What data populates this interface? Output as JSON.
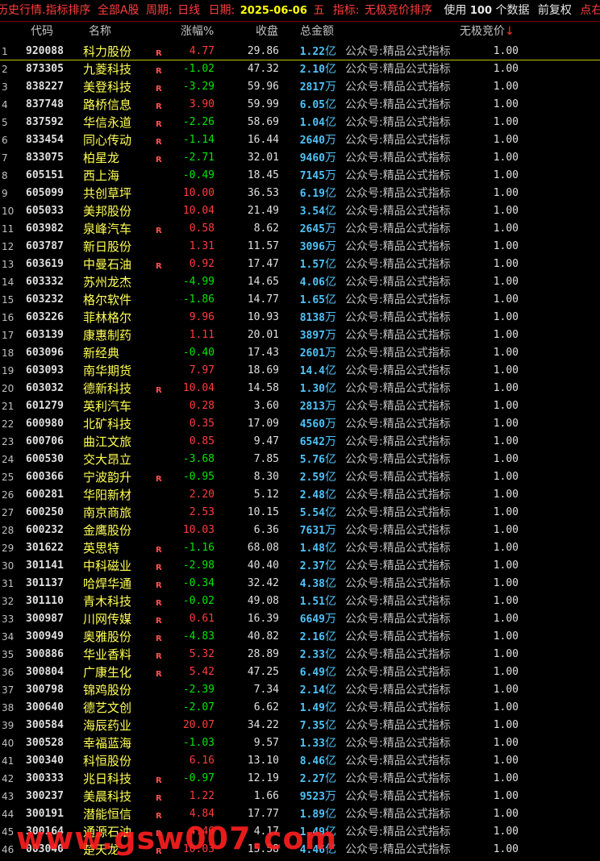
{
  "titlebar": {
    "part1": "历史行情.指标排序",
    "part2": "全部A股",
    "period_label": "周期:",
    "period_value": "日线",
    "date_label": "日期:",
    "date_value": "2025-06-06",
    "weekday": "五",
    "indicator_label": "指标:",
    "indicator_value": "无极竞价排序",
    "use_label": "使用",
    "use_count": "100",
    "use_suffix": "个数据",
    "adjust": "前复权",
    "tail": "点右"
  },
  "columns": {
    "code": "代码",
    "name": "名称",
    "change": "涨幅%",
    "close": "收盘",
    "amount": "总金额",
    "indicator": "无极竞价",
    "sort_arrow": "↓"
  },
  "colors": {
    "up": "#ff3c3c",
    "down": "#00e600",
    "name": "#ffff54",
    "amount": "#4fc3f7"
  },
  "rows": [
    {
      "idx": "1",
      "code": "920088",
      "name": "科力股份",
      "r": "R",
      "chg": "4.77",
      "close": "29.86",
      "amt": "1.22",
      "unit": "亿",
      "note": "公众号:精品公式指标",
      "val": "1.00"
    },
    {
      "idx": "2",
      "code": "873305",
      "name": "九菱科技",
      "r": "R",
      "chg": "-1.02",
      "close": "47.32",
      "amt": "2.10",
      "unit": "亿",
      "note": "公众号:精品公式指标",
      "val": "1.00"
    },
    {
      "idx": "3",
      "code": "838227",
      "name": "美登科技",
      "r": "R",
      "chg": "-3.29",
      "close": "59.96",
      "amt": "2817",
      "unit": "万",
      "note": "公众号:精品公式指标",
      "val": "1.00"
    },
    {
      "idx": "4",
      "code": "837748",
      "name": "路桥信息",
      "r": "R",
      "chg": "3.90",
      "close": "59.99",
      "amt": "6.05",
      "unit": "亿",
      "note": "公众号:精品公式指标",
      "val": "1.00"
    },
    {
      "idx": "5",
      "code": "837592",
      "name": "华信永道",
      "r": "R",
      "chg": "-2.26",
      "close": "58.69",
      "amt": "1.04",
      "unit": "亿",
      "note": "公众号:精品公式指标",
      "val": "1.00"
    },
    {
      "idx": "6",
      "code": "833454",
      "name": "同心传动",
      "r": "R",
      "chg": "-1.14",
      "close": "16.44",
      "amt": "2640",
      "unit": "万",
      "note": "公众号:精品公式指标",
      "val": "1.00"
    },
    {
      "idx": "7",
      "code": "833075",
      "name": "柏星龙",
      "r": "R",
      "chg": "-2.71",
      "close": "32.01",
      "amt": "9460",
      "unit": "万",
      "note": "公众号:精品公式指标",
      "val": "1.00"
    },
    {
      "idx": "8",
      "code": "605151",
      "name": "西上海",
      "r": "",
      "chg": "-0.49",
      "close": "18.45",
      "amt": "7145",
      "unit": "万",
      "note": "公众号:精品公式指标",
      "val": "1.00"
    },
    {
      "idx": "9",
      "code": "605099",
      "name": "共创草坪",
      "r": "",
      "chg": "10.00",
      "close": "36.53",
      "amt": "6.19",
      "unit": "亿",
      "note": "公众号:精品公式指标",
      "val": "1.00"
    },
    {
      "idx": "10",
      "code": "605033",
      "name": "美邦股份",
      "r": "",
      "chg": "10.04",
      "close": "21.49",
      "amt": "3.54",
      "unit": "亿",
      "note": "公众号:精品公式指标",
      "val": "1.00"
    },
    {
      "idx": "11",
      "code": "603982",
      "name": "泉峰汽车",
      "r": "R",
      "chg": "0.58",
      "close": "8.62",
      "amt": "2645",
      "unit": "万",
      "note": "公众号:精品公式指标",
      "val": "1.00"
    },
    {
      "idx": "12",
      "code": "603787",
      "name": "新日股份",
      "r": "",
      "chg": "1.31",
      "close": "11.57",
      "amt": "3096",
      "unit": "万",
      "note": "公众号:精品公式指标",
      "val": "1.00"
    },
    {
      "idx": "13",
      "code": "603619",
      "name": "中曼石油",
      "r": "R",
      "chg": "0.92",
      "close": "17.47",
      "amt": "1.57",
      "unit": "亿",
      "note": "公众号:精品公式指标",
      "val": "1.00"
    },
    {
      "idx": "14",
      "code": "603332",
      "name": "苏州龙杰",
      "r": "",
      "chg": "-4.99",
      "close": "14.65",
      "amt": "4.06",
      "unit": "亿",
      "note": "公众号:精品公式指标",
      "val": "1.00"
    },
    {
      "idx": "15",
      "code": "603232",
      "name": "格尔软件",
      "r": "",
      "chg": "-1.86",
      "close": "14.77",
      "amt": "1.65",
      "unit": "亿",
      "note": "公众号:精品公式指标",
      "val": "1.00"
    },
    {
      "idx": "16",
      "code": "603226",
      "name": "菲林格尔",
      "r": "",
      "chg": "9.96",
      "close": "10.93",
      "amt": "8138",
      "unit": "万",
      "note": "公众号:精品公式指标",
      "val": "1.00"
    },
    {
      "idx": "17",
      "code": "603139",
      "name": "康惠制药",
      "r": "",
      "chg": "1.11",
      "close": "20.01",
      "amt": "3897",
      "unit": "万",
      "note": "公众号:精品公式指标",
      "val": "1.00"
    },
    {
      "idx": "18",
      "code": "603096",
      "name": "新经典",
      "r": "",
      "chg": "-0.40",
      "close": "17.43",
      "amt": "2601",
      "unit": "万",
      "note": "公众号:精品公式指标",
      "val": "1.00"
    },
    {
      "idx": "19",
      "code": "603093",
      "name": "南华期货",
      "r": "",
      "chg": "7.97",
      "close": "18.69",
      "amt": "14.4",
      "unit": "亿",
      "note": "公众号:精品公式指标",
      "val": "1.00"
    },
    {
      "idx": "20",
      "code": "603032",
      "name": "德新科技",
      "r": "R",
      "chg": "10.04",
      "close": "14.58",
      "amt": "1.30",
      "unit": "亿",
      "note": "公众号:精品公式指标",
      "val": "1.00"
    },
    {
      "idx": "21",
      "code": "601279",
      "name": "英利汽车",
      "r": "",
      "chg": "0.28",
      "close": "3.60",
      "amt": "2813",
      "unit": "万",
      "note": "公众号:精品公式指标",
      "val": "1.00"
    },
    {
      "idx": "22",
      "code": "600980",
      "name": "北矿科技",
      "r": "",
      "chg": "0.35",
      "close": "17.09",
      "amt": "4560",
      "unit": "万",
      "note": "公众号:精品公式指标",
      "val": "1.00"
    },
    {
      "idx": "23",
      "code": "600706",
      "name": "曲江文旅",
      "r": "",
      "chg": "0.85",
      "close": "9.47",
      "amt": "6542",
      "unit": "万",
      "note": "公众号:精品公式指标",
      "val": "1.00"
    },
    {
      "idx": "24",
      "code": "600530",
      "name": "交大昂立",
      "r": "",
      "chg": "-3.68",
      "close": "7.85",
      "amt": "5.76",
      "unit": "亿",
      "note": "公众号:精品公式指标",
      "val": "1.00"
    },
    {
      "idx": "25",
      "code": "600366",
      "name": "宁波韵升",
      "r": "R",
      "chg": "-0.95",
      "close": "8.30",
      "amt": "2.59",
      "unit": "亿",
      "note": "公众号:精品公式指标",
      "val": "1.00"
    },
    {
      "idx": "26",
      "code": "600281",
      "name": "华阳新材",
      "r": "",
      "chg": "2.20",
      "close": "5.12",
      "amt": "2.48",
      "unit": "亿",
      "note": "公众号:精品公式指标",
      "val": "1.00"
    },
    {
      "idx": "27",
      "code": "600250",
      "name": "南京商旅",
      "r": "",
      "chg": "2.53",
      "close": "10.15",
      "amt": "5.54",
      "unit": "亿",
      "note": "公众号:精品公式指标",
      "val": "1.00"
    },
    {
      "idx": "28",
      "code": "600232",
      "name": "金鹰股份",
      "r": "",
      "chg": "10.03",
      "close": "6.36",
      "amt": "7631",
      "unit": "万",
      "note": "公众号:精品公式指标",
      "val": "1.00"
    },
    {
      "idx": "29",
      "code": "301622",
      "name": "英思特",
      "r": "R",
      "chg": "-1.16",
      "close": "68.08",
      "amt": "1.48",
      "unit": "亿",
      "note": "公众号:精品公式指标",
      "val": "1.00"
    },
    {
      "idx": "30",
      "code": "301141",
      "name": "中科磁业",
      "r": "R",
      "chg": "-2.98",
      "close": "40.40",
      "amt": "2.37",
      "unit": "亿",
      "note": "公众号:精品公式指标",
      "val": "1.00"
    },
    {
      "idx": "31",
      "code": "301137",
      "name": "哈焊华通",
      "r": "R",
      "chg": "-0.34",
      "close": "32.42",
      "amt": "4.38",
      "unit": "亿",
      "note": "公众号:精品公式指标",
      "val": "1.00"
    },
    {
      "idx": "32",
      "code": "301110",
      "name": "青木科技",
      "r": "R",
      "chg": "-0.02",
      "close": "49.08",
      "amt": "1.51",
      "unit": "亿",
      "note": "公众号:精品公式指标",
      "val": "1.00"
    },
    {
      "idx": "33",
      "code": "300987",
      "name": "川网传媒",
      "r": "R",
      "chg": "0.61",
      "close": "16.39",
      "amt": "6649",
      "unit": "万",
      "note": "公众号:精品公式指标",
      "val": "1.00"
    },
    {
      "idx": "34",
      "code": "300949",
      "name": "奥雅股份",
      "r": "R",
      "chg": "-4.83",
      "close": "40.82",
      "amt": "2.16",
      "unit": "亿",
      "note": "公众号:精品公式指标",
      "val": "1.00"
    },
    {
      "idx": "35",
      "code": "300886",
      "name": "华业香料",
      "r": "R",
      "chg": "5.32",
      "close": "28.89",
      "amt": "2.33",
      "unit": "亿",
      "note": "公众号:精品公式指标",
      "val": "1.00"
    },
    {
      "idx": "36",
      "code": "300804",
      "name": "广康生化",
      "r": "R",
      "chg": "5.42",
      "close": "47.25",
      "amt": "6.49",
      "unit": "亿",
      "note": "公众号:精品公式指标",
      "val": "1.00"
    },
    {
      "idx": "37",
      "code": "300798",
      "name": "锦鸡股份",
      "r": "",
      "chg": "-2.39",
      "close": "7.34",
      "amt": "2.14",
      "unit": "亿",
      "note": "公众号:精品公式指标",
      "val": "1.00"
    },
    {
      "idx": "38",
      "code": "300640",
      "name": "德艺文创",
      "r": "",
      "chg": "-2.07",
      "close": "6.62",
      "amt": "1.49",
      "unit": "亿",
      "note": "公众号:精品公式指标",
      "val": "1.00"
    },
    {
      "idx": "39",
      "code": "300584",
      "name": "海辰药业",
      "r": "",
      "chg": "20.07",
      "close": "34.22",
      "amt": "7.35",
      "unit": "亿",
      "note": "公众号:精品公式指标",
      "val": "1.00"
    },
    {
      "idx": "40",
      "code": "300528",
      "name": "幸福蓝海",
      "r": "",
      "chg": "-1.03",
      "close": "9.57",
      "amt": "1.33",
      "unit": "亿",
      "note": "公众号:精品公式指标",
      "val": "1.00"
    },
    {
      "idx": "41",
      "code": "300340",
      "name": "科恒股份",
      "r": "",
      "chg": "6.16",
      "close": "13.10",
      "amt": "8.46",
      "unit": "亿",
      "note": "公众号:精品公式指标",
      "val": "1.00"
    },
    {
      "idx": "42",
      "code": "300333",
      "name": "兆日科技",
      "r": "R",
      "chg": "-0.97",
      "close": "12.19",
      "amt": "2.27",
      "unit": "亿",
      "note": "公众号:精品公式指标",
      "val": "1.00"
    },
    {
      "idx": "43",
      "code": "300237",
      "name": "美晨科技",
      "r": "R",
      "chg": "1.22",
      "close": "1.66",
      "amt": "9523",
      "unit": "万",
      "note": "公众号:精品公式指标",
      "val": "1.00"
    },
    {
      "idx": "44",
      "code": "300191",
      "name": "潜能恒信",
      "r": "R",
      "chg": "4.84",
      "close": "17.77",
      "amt": "1.89",
      "unit": "亿",
      "note": "公众号:精品公式指标",
      "val": "1.00"
    },
    {
      "idx": "45",
      "code": "300164",
      "name": "通源石油",
      "r": "R",
      "chg": "4.46",
      "close": "4.17",
      "amt": "1.49",
      "unit": "亿",
      "note": "公众号:精品公式指标",
      "val": "1.00"
    },
    {
      "idx": "46",
      "code": "003040",
      "name": "楚天龙",
      "r": "R",
      "chg": "10.03",
      "close": "15.58",
      "amt": "4.46",
      "unit": "亿",
      "note": "公众号:精品公式指标",
      "val": "1.00"
    }
  ],
  "watermark": "www.gsw007.com"
}
